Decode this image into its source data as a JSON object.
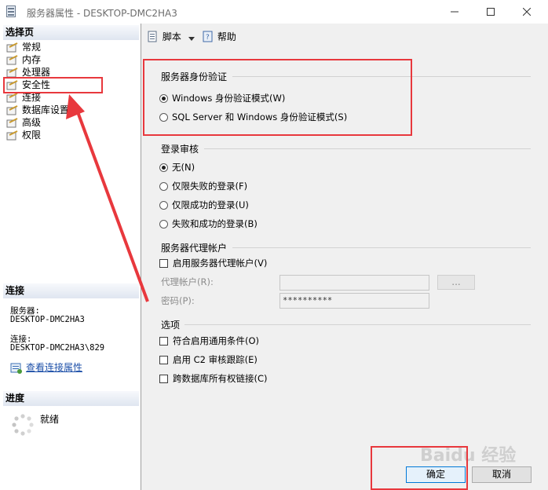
{
  "window": {
    "title": "服务器属性 - DESKTOP-DMC2HA3",
    "app_icon": "server-properties-icon",
    "controls": [
      "minimize-icon",
      "maximize-icon",
      "close-icon"
    ]
  },
  "sidebar": {
    "select_page_header": "选择页",
    "items": [
      {
        "label": "常规",
        "icon": "page-icon"
      },
      {
        "label": "内存",
        "icon": "page-icon"
      },
      {
        "label": "处理器",
        "icon": "page-icon"
      },
      {
        "label": "安全性",
        "icon": "page-icon",
        "selected": true
      },
      {
        "label": "连接",
        "icon": "page-icon"
      },
      {
        "label": "数据库设置",
        "icon": "page-icon"
      },
      {
        "label": "高级",
        "icon": "page-icon"
      },
      {
        "label": "权限",
        "icon": "page-icon"
      }
    ],
    "connection": {
      "header": "连接",
      "server_label": "服务器:",
      "server_value": "DESKTOP-DMC2HA3",
      "conn_label": "连接:",
      "conn_value": "DESKTOP-DMC2HA3\\829",
      "view_link": "查看连接属性"
    },
    "progress": {
      "header": "进度",
      "status": "就绪"
    }
  },
  "toolbar": {
    "script_label": "脚本",
    "help_label": "帮助"
  },
  "auth": {
    "title": "服务器身份验证",
    "options": [
      {
        "label": "Windows 身份验证模式(W)",
        "checked": true
      },
      {
        "label": "SQL Server 和 Windows 身份验证模式(S)",
        "checked": false
      }
    ]
  },
  "audit": {
    "title": "登录审核",
    "options": [
      {
        "label": "无(N)",
        "checked": true
      },
      {
        "label": "仅限失败的登录(F)",
        "checked": false
      },
      {
        "label": "仅限成功的登录(U)",
        "checked": false
      },
      {
        "label": "失败和成功的登录(B)",
        "checked": false
      }
    ]
  },
  "proxy": {
    "title": "服务器代理帐户",
    "enable_label": "启用服务器代理帐户(V)",
    "account_label": "代理帐户(R):",
    "account_value": "",
    "password_label": "密码(P):",
    "password_value": "**********",
    "browse_label": "..."
  },
  "options": {
    "title": "选项",
    "items": [
      {
        "label": "符合启用通用条件(O)",
        "checked": false
      },
      {
        "label": "启用 C2 审核跟踪(E)",
        "checked": false
      },
      {
        "label": "跨数据库所有权链接(C)",
        "checked": false
      }
    ]
  },
  "footer": {
    "ok_label": "确定",
    "cancel_label": "取消"
  },
  "watermark": "Baidu 经验",
  "annotation_color": "#e8383d"
}
